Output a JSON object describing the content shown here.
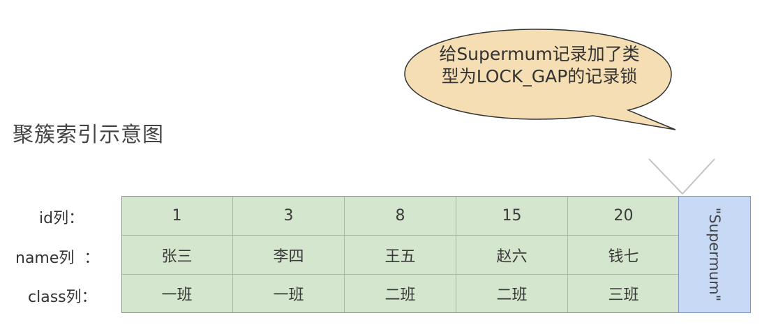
{
  "title": "聚簇索引示意图",
  "callout": {
    "line1": "给Supermum记录加了类",
    "line2": "型为LOCK_GAP的记录锁"
  },
  "row_labels": {
    "id": "id列：",
    "name": "name列  ：",
    "class": "class列："
  },
  "records": [
    {
      "id": "1",
      "name": "张三",
      "class": "一班"
    },
    {
      "id": "3",
      "name": "李四",
      "class": "一班"
    },
    {
      "id": "8",
      "name": "王五",
      "class": "二班"
    },
    {
      "id": "15",
      "name": "赵六",
      "class": "二班"
    },
    {
      "id": "20",
      "name": "钱七",
      "class": "三班"
    }
  ],
  "supremum_label": "\"Supermum\"",
  "colors": {
    "record_fill": "#d4e6cd",
    "supremum_fill": "#c8d9f5",
    "bubble_fill": "#f5deb3"
  }
}
